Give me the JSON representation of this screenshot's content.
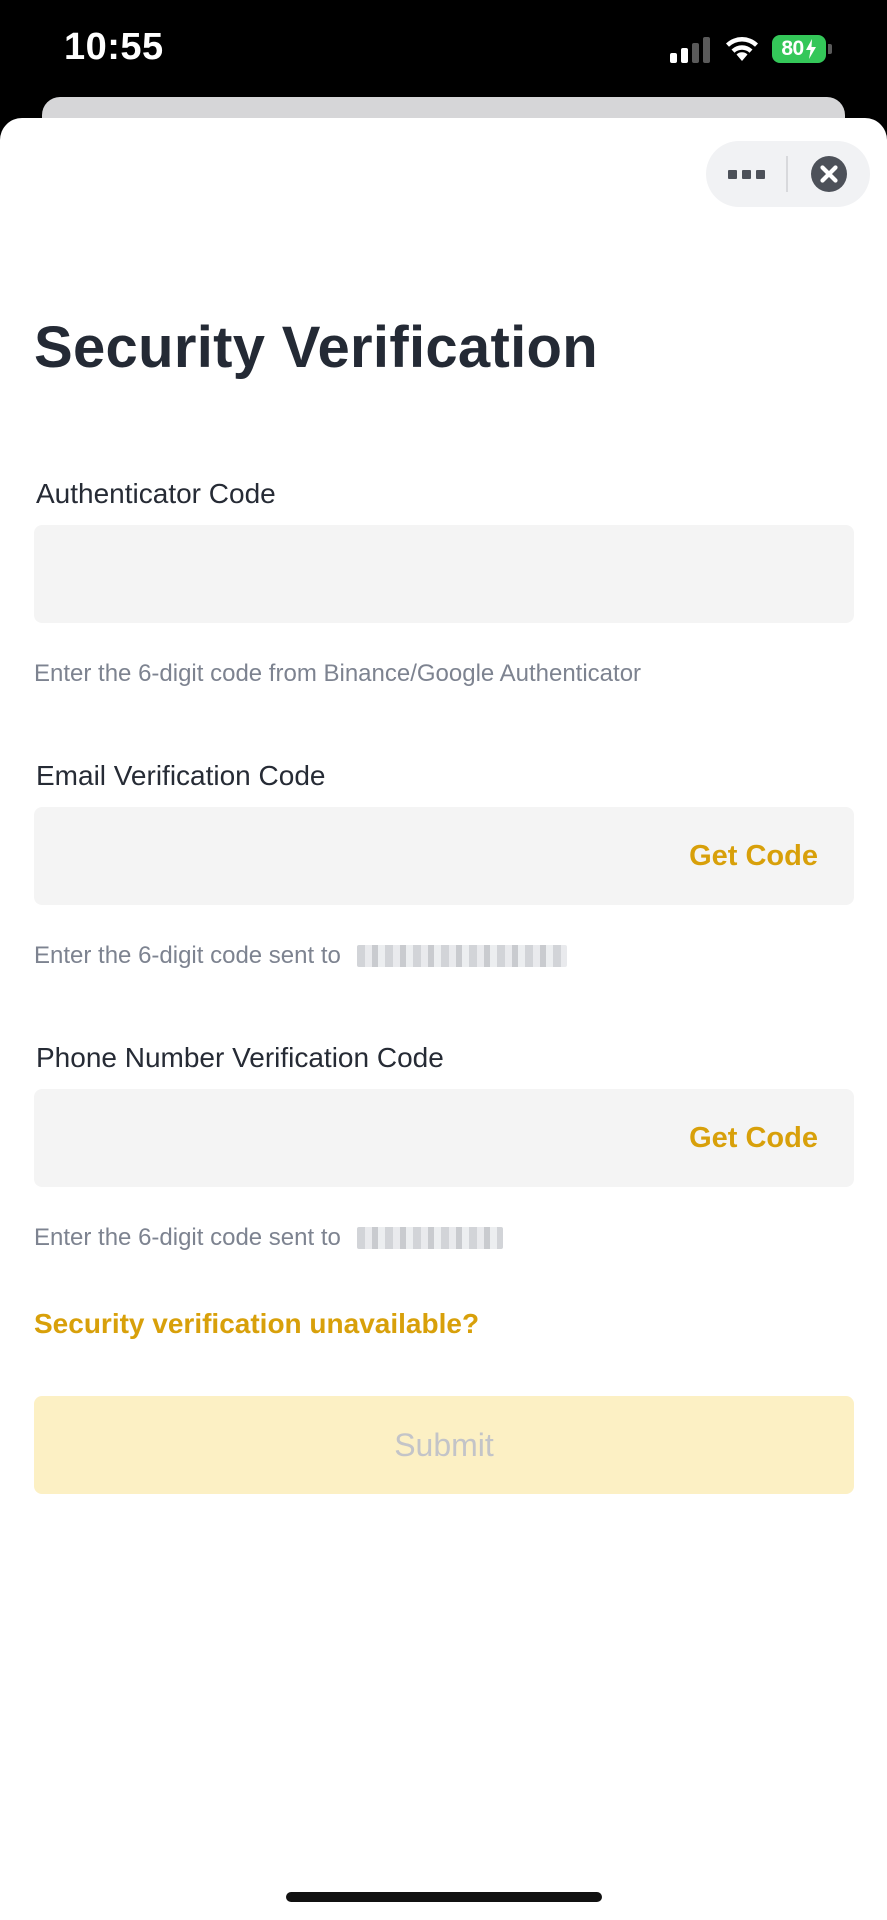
{
  "status_bar": {
    "time": "10:55",
    "battery": "80"
  },
  "header": {
    "more_icon": "more-dots-icon",
    "close_icon": "close-circle-icon"
  },
  "page": {
    "title": "Security Verification"
  },
  "fields": {
    "authenticator": {
      "label": "Authenticator Code",
      "value": "",
      "hint": "Enter the 6-digit code from Binance/Google Authenticator"
    },
    "email": {
      "label": "Email Verification Code",
      "value": "",
      "action": "Get Code",
      "hint": "Enter the 6-digit code sent to"
    },
    "phone": {
      "label": "Phone Number Verification Code",
      "value": "",
      "action": "Get Code",
      "hint": "Enter the 6-digit code sent to"
    }
  },
  "links": {
    "unavailable": "Security verification unavailable?"
  },
  "actions": {
    "submit": "Submit"
  },
  "colors": {
    "accent": "#d8a00a",
    "submit_disabled_bg": "#fcf0c4",
    "input_bg": "#f4f4f4",
    "title": "#242a35",
    "battery": "#34c759"
  }
}
